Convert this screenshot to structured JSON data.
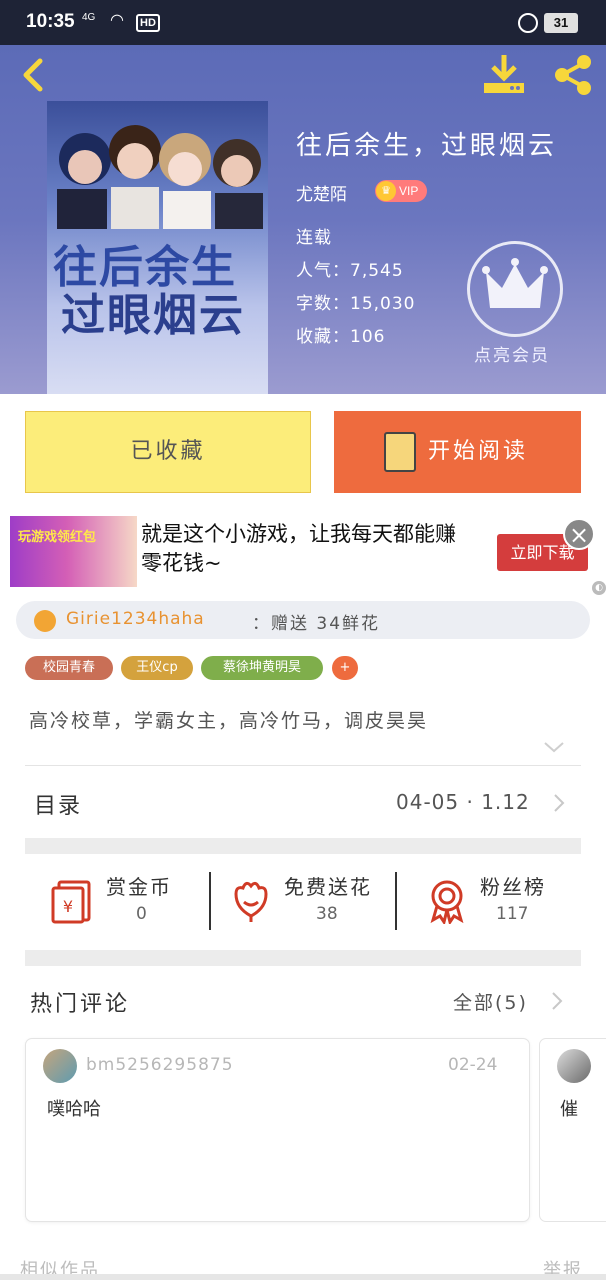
{
  "status_bar": {
    "time": "10:35",
    "signal": "4G",
    "hd": "HD",
    "battery": "31"
  },
  "book": {
    "title": "往后余生，过眼烟云",
    "author": "尤楚陌",
    "vip": "VIP",
    "status": "连载",
    "popularity": "人气：7,545",
    "words": "字数：15,030",
    "favorites": "收藏：106",
    "cover_line1": "往后余生",
    "cover_line2": "过眼烟云"
  },
  "member": {
    "label": "点亮会员"
  },
  "actions": {
    "collected_label": "已收藏",
    "read_label": "开始阅读"
  },
  "ad": {
    "text": "就是这个小游戏，让我每天都能赚零花钱~",
    "button": "立即下载",
    "close": "×",
    "image_text": "玩游戏领红包",
    "mini": "◐"
  },
  "gift": {
    "user": "Girie1234haha",
    "message": "：赠送 34鲜花"
  },
  "tags": [
    {
      "label": "校园青春",
      "color": "#c96f56"
    },
    {
      "label": "王仪cp",
      "color": "#d4a23d"
    },
    {
      "label": "蔡徐坤黄明昊",
      "color": "#7fae4b"
    },
    {
      "label": "+",
      "color": "#ee6b3e"
    }
  ],
  "summary": "高冷校草，学霸女主，高冷竹马，调皮昊昊",
  "toc": {
    "label": "目录",
    "value": "04-05 · 1.12"
  },
  "stats": [
    {
      "label": "赏金币",
      "value": "0"
    },
    {
      "label": "免费送花",
      "value": "38"
    },
    {
      "label": "粉丝榜",
      "value": "117"
    }
  ],
  "comments_section": {
    "title": "热门评论",
    "all": "全部(5)"
  },
  "comments": [
    {
      "user": "bm5256295875",
      "date": "02-24",
      "text": "噗哈哈"
    },
    {
      "text": "催"
    }
  ],
  "footer": {
    "similar": "相似作品",
    "report": "举报"
  },
  "colors": {
    "orange": "#ee6b3e",
    "yellow": "#fced7a",
    "header": "#6b76bf",
    "icon_red": "#d03b26"
  }
}
